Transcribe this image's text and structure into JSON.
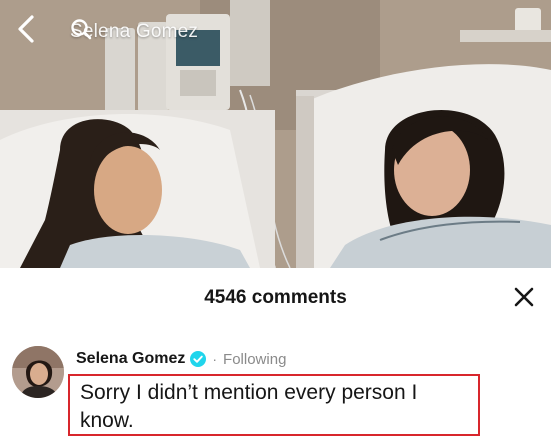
{
  "header": {
    "search_query": "Selena Gomez",
    "back_icon": "chevron-left-icon",
    "search_icon": "search-icon"
  },
  "comments_panel": {
    "count_label": "4546 comments",
    "close_icon": "close-icon"
  },
  "comment": {
    "username": "Selena Gomez",
    "verified": true,
    "separator": "·",
    "follow_status": "Following",
    "text": "Sorry I didn’t mention every person I know."
  },
  "colors": {
    "verified_badge": "#20d5ec",
    "highlight_box": "#d8262c",
    "text_primary": "#161616",
    "text_secondary": "#8a8a8a"
  }
}
